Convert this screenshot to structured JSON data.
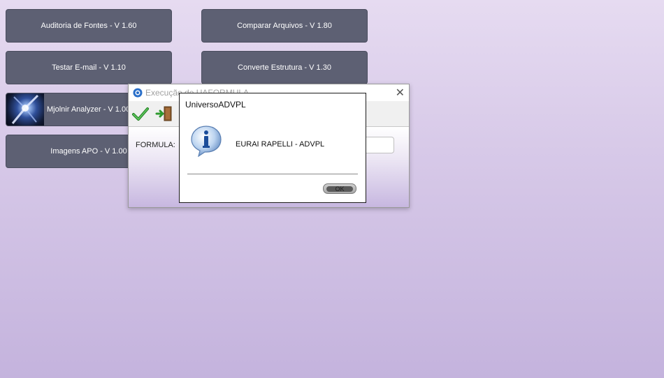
{
  "buttons": {
    "auditoria": "Auditoria de Fontes - V 1.60",
    "comparar": "Comparar Arquivos - V 1.80",
    "testar_email": "Testar E-mail - V 1.10",
    "converte": "Converte Estrutura - V 1.30",
    "mjolnir": "Mjolnir Analyzer - V 1.00",
    "imagens_apo": "Imagens APO - V 1.00"
  },
  "window": {
    "title": "Execução de UAFORMULA",
    "formula_label": "FORMULA:",
    "formula_value": "",
    "toolbar_icons": [
      "checkmark-icon",
      "exit-door-icon"
    ]
  },
  "dialog": {
    "title": "UniversoADVPL",
    "message": "EURAI RAPELLI - ADVPL",
    "ok_label": "OK",
    "icon": "info-icon"
  },
  "colors": {
    "button_bg": "#5d6073",
    "background_top": "#e6dbf1",
    "background_bottom": "#c4b3dd"
  }
}
